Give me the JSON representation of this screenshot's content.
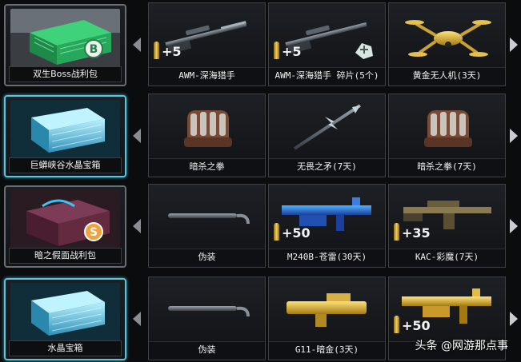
{
  "rows": [
    {
      "chest": "双生Boss战利包",
      "badge": "B",
      "items": [
        {
          "label": "AWM-深海猎手",
          "qty": "+5",
          "icon": "sniper-rifle-icon"
        },
        {
          "label": "AWM-深海猎手 碎片(5个)",
          "qty": "+5",
          "icon": "sniper-rifle-fragment-icon"
        },
        {
          "label": "黄金无人机(3天)",
          "qty": "",
          "icon": "gold-drone-icon"
        }
      ]
    },
    {
      "chest": "巨蟒峡谷水晶宝箱",
      "items": [
        {
          "label": "暗杀之拳",
          "qty": "",
          "icon": "glove-icon"
        },
        {
          "label": "无畏之矛(7天)",
          "qty": "",
          "icon": "spear-icon"
        },
        {
          "label": "暗杀之拳(7天)",
          "qty": "",
          "icon": "glove-icon"
        }
      ]
    },
    {
      "chest": "暗之假面战利包",
      "badge": "S",
      "items": [
        {
          "label": "伪装",
          "qty": "",
          "icon": "disguise-rod-icon"
        },
        {
          "label": "M240B-苍雷(30天)",
          "qty": "+50",
          "icon": "machine-gun-icon"
        },
        {
          "label": "KAC-彩魔(7天)",
          "qty": "+35",
          "icon": "rifle-icon"
        }
      ]
    },
    {
      "chest": "水晶宝箱",
      "items": [
        {
          "label": "伪装",
          "qty": "",
          "icon": "disguise-rod-icon"
        },
        {
          "label": "G11-暗金(3天)",
          "qty": "",
          "icon": "gold-rifle-icon"
        },
        {
          "label": "",
          "qty": "+50",
          "icon": "gold-machine-gun-icon"
        }
      ]
    }
  ],
  "watermark": "头条 @网游那点事",
  "colors": {
    "selected_border": "#5fc4d8",
    "gold": "#f3cf5c"
  }
}
